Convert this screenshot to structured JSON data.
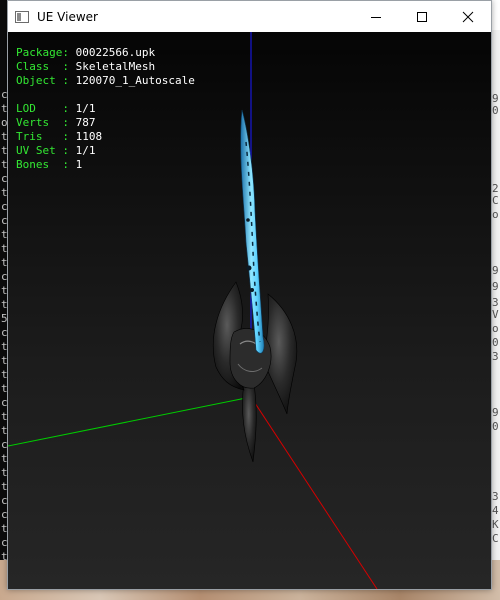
{
  "window": {
    "title": "UE Viewer"
  },
  "viewer": {
    "info": [
      {
        "key": "Package",
        "value": "00022566.upk"
      },
      {
        "key": "Class  ",
        "value": "SkeletalMesh"
      },
      {
        "key": "Object ",
        "value": "120070_1_Autoscale"
      },
      {
        "key": "",
        "value": ""
      },
      {
        "key": "LOD    ",
        "value": "1/1"
      },
      {
        "key": "Verts  ",
        "value": "787"
      },
      {
        "key": "Tris   ",
        "value": "1108"
      },
      {
        "key": "UV Set ",
        "value": "1/1"
      },
      {
        "key": "Bones  ",
        "value": "1"
      }
    ]
  },
  "background_console": {
    "chars": [
      "c",
      "t",
      "o",
      "t",
      "t",
      "t",
      "c",
      "t",
      "c",
      "c",
      "t",
      "t",
      "t",
      "c",
      "t",
      "t",
      "5",
      "c",
      "t",
      "t",
      "t",
      "t",
      "c",
      "t",
      "t",
      "c",
      "t",
      "t",
      "t",
      "c",
      "c",
      "t",
      "c",
      "t",
      "t"
    ]
  },
  "background_right": {
    "chars": [
      "9",
      "0",
      "2",
      "C",
      "o",
      "9",
      "9",
      "3",
      "V",
      "o",
      "0",
      "3",
      "9",
      "0",
      "3",
      "4",
      "K",
      "C"
    ]
  },
  "colors": {
    "label_green": "#33e833",
    "value_white": "#ffffff",
    "axis_x": "#d40000",
    "axis_y": "#00cc00",
    "axis_z": "#1a1aff",
    "blade_cyan": "#5fd3ff"
  }
}
